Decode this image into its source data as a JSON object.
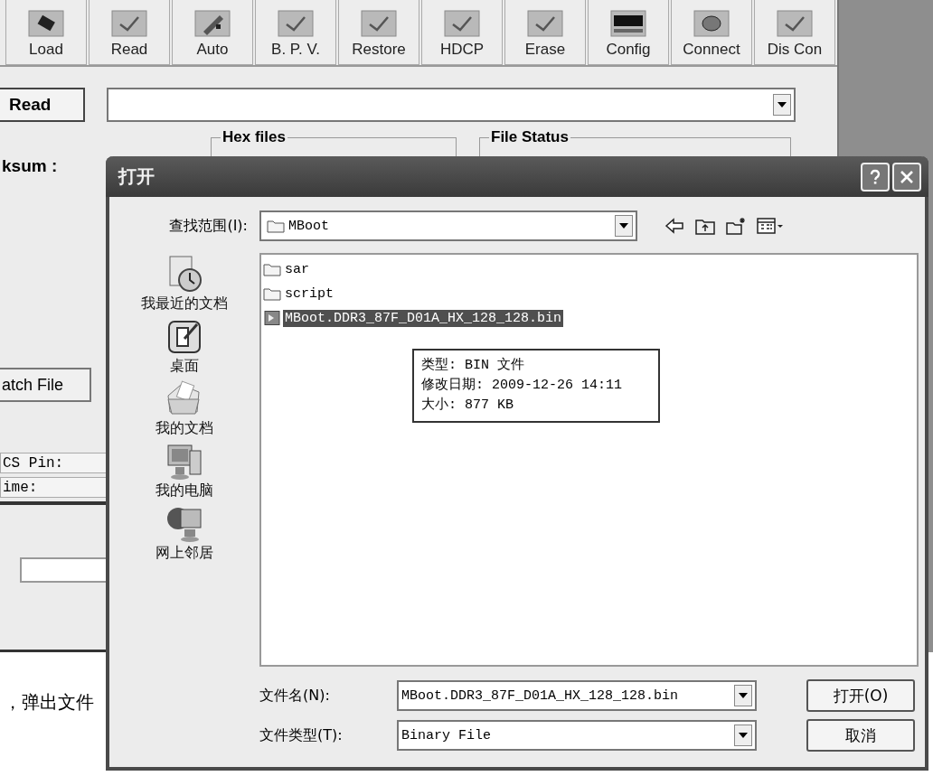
{
  "app": {
    "toolbar": [
      {
        "label": "Load"
      },
      {
        "label": "Read"
      },
      {
        "label": "Auto"
      },
      {
        "label": "B. P. V."
      },
      {
        "label": "Restore"
      },
      {
        "label": "HDCP"
      },
      {
        "label": "Erase"
      },
      {
        "label": "Config"
      },
      {
        "label": "Connect"
      },
      {
        "label": "Dis Con"
      }
    ],
    "read_button": "Read",
    "checksum_label": "ksum :",
    "group_boxes": [
      {
        "title": "Hex files"
      },
      {
        "title": "File Status"
      }
    ],
    "batch_button": "atch File",
    "fields": [
      {
        "label": "CS Pin:"
      },
      {
        "label": "ime:"
      }
    ]
  },
  "document_text": "，弹出文件",
  "dialog": {
    "title": "打开",
    "look_in_label": "查找范围(I):",
    "look_in_value": "MBoot",
    "places": [
      {
        "label": "我最近的文档"
      },
      {
        "label": "桌面"
      },
      {
        "label": "我的文档"
      },
      {
        "label": "我的电脑"
      },
      {
        "label": "网上邻居"
      }
    ],
    "files": [
      {
        "name": "sar",
        "kind": "folder",
        "selected": false
      },
      {
        "name": "script",
        "kind": "folder",
        "selected": false
      },
      {
        "name": "MBoot.DDR3_87F_D01A_HX_128_128.bin",
        "kind": "file",
        "selected": true
      }
    ],
    "tooltip": [
      "类型: BIN 文件",
      "修改日期: 2009-12-26 14:11",
      "大小: 877 KB"
    ],
    "file_name_label": "文件名(N):",
    "file_name_value": "MBoot.DDR3_87F_D01A_HX_128_128.bin",
    "file_type_label": "文件类型(T):",
    "file_type_value": "Binary File",
    "buttons": [
      {
        "label": "打开(O)"
      },
      {
        "label": "取消"
      }
    ]
  }
}
